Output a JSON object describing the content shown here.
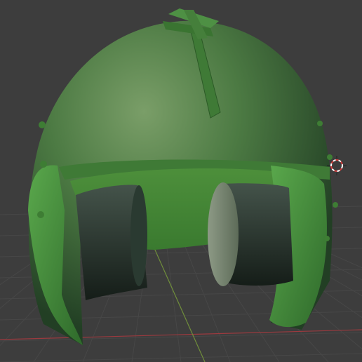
{
  "viewport": {
    "background": "#3d3d3d",
    "grid_color": "#474747",
    "x_axis_color": "#9b3a3f",
    "y_axis_color": "#6f8d3b",
    "grid_visible": true
  },
  "model": {
    "name": "",
    "shell_color": "#3f6f36",
    "shell_highlight": "#6f9a5e",
    "rim_color": "#4f9f42",
    "earcup_color": "#2b3a33",
    "earcup_face_color": "#7f8d78",
    "rivet_color": "#3e7d34"
  },
  "cursor": {
    "icon": "3d-cursor-icon",
    "ring_colors": [
      "#ffffff",
      "#d23b3b"
    ]
  }
}
